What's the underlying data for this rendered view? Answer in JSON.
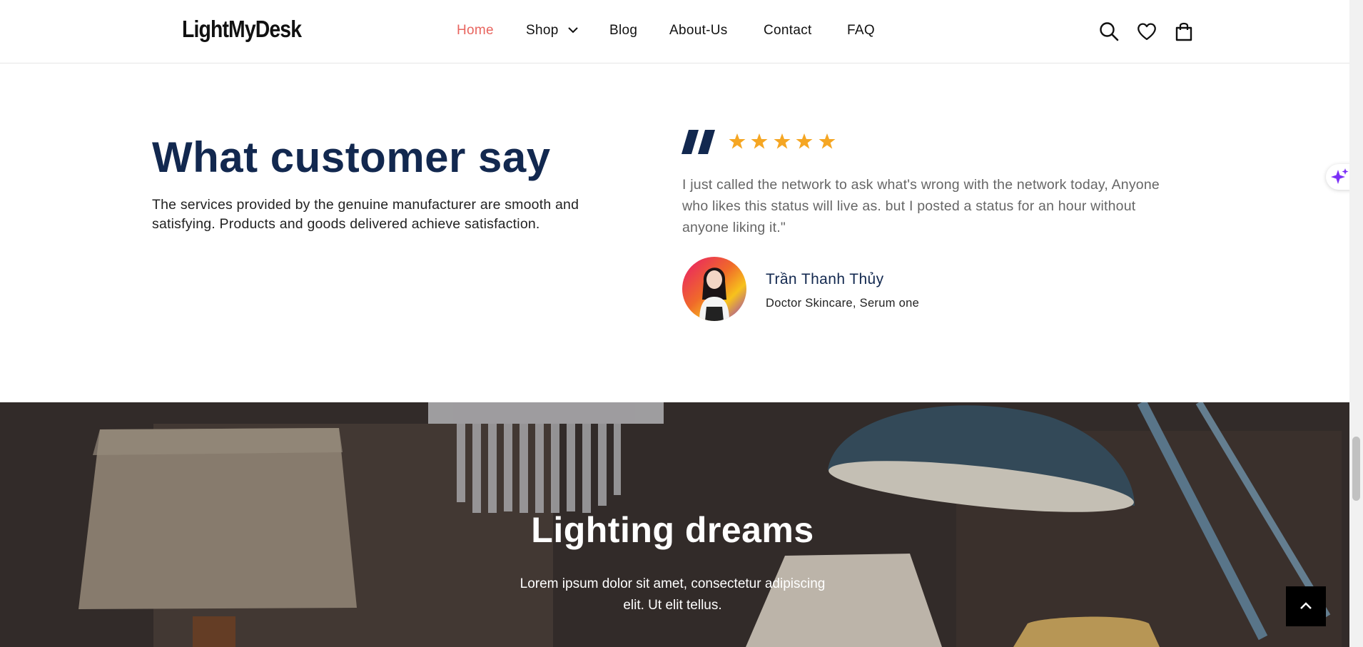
{
  "header": {
    "logo": "LightMyDesk",
    "nav": [
      {
        "label": "Home",
        "active": true
      },
      {
        "label": "Shop",
        "has_dropdown": true
      },
      {
        "label": "Blog"
      },
      {
        "label": "About-Us"
      },
      {
        "label": "Contact"
      },
      {
        "label": "FAQ"
      }
    ],
    "icons": [
      "search-icon",
      "heart-icon",
      "shopping-bag-icon"
    ]
  },
  "testimonials": {
    "title": "What customer say",
    "description": "The services provided by the genuine manufacturer are smooth and satisfying. Products and goods delivered achieve satisfaction.",
    "rating": 5,
    "review": "I just called the network to ask what's wrong with the network today, Anyone who likes this status will live as. but I posted a status for an hour without anyone liking it.\"",
    "reviewer_name": "Trần Thanh Thủy",
    "reviewer_role": "Doctor Skincare, Serum one"
  },
  "banner": {
    "title": "Lighting dreams",
    "subtitle": "Lorem ipsum dolor sit amet, consectetur adipiscing elit. Ut elit tellus."
  },
  "colors": {
    "accent": "#e8655f",
    "heading": "#12284f",
    "star": "#f5a623",
    "ai_sparkle": "#7b2ff7"
  }
}
